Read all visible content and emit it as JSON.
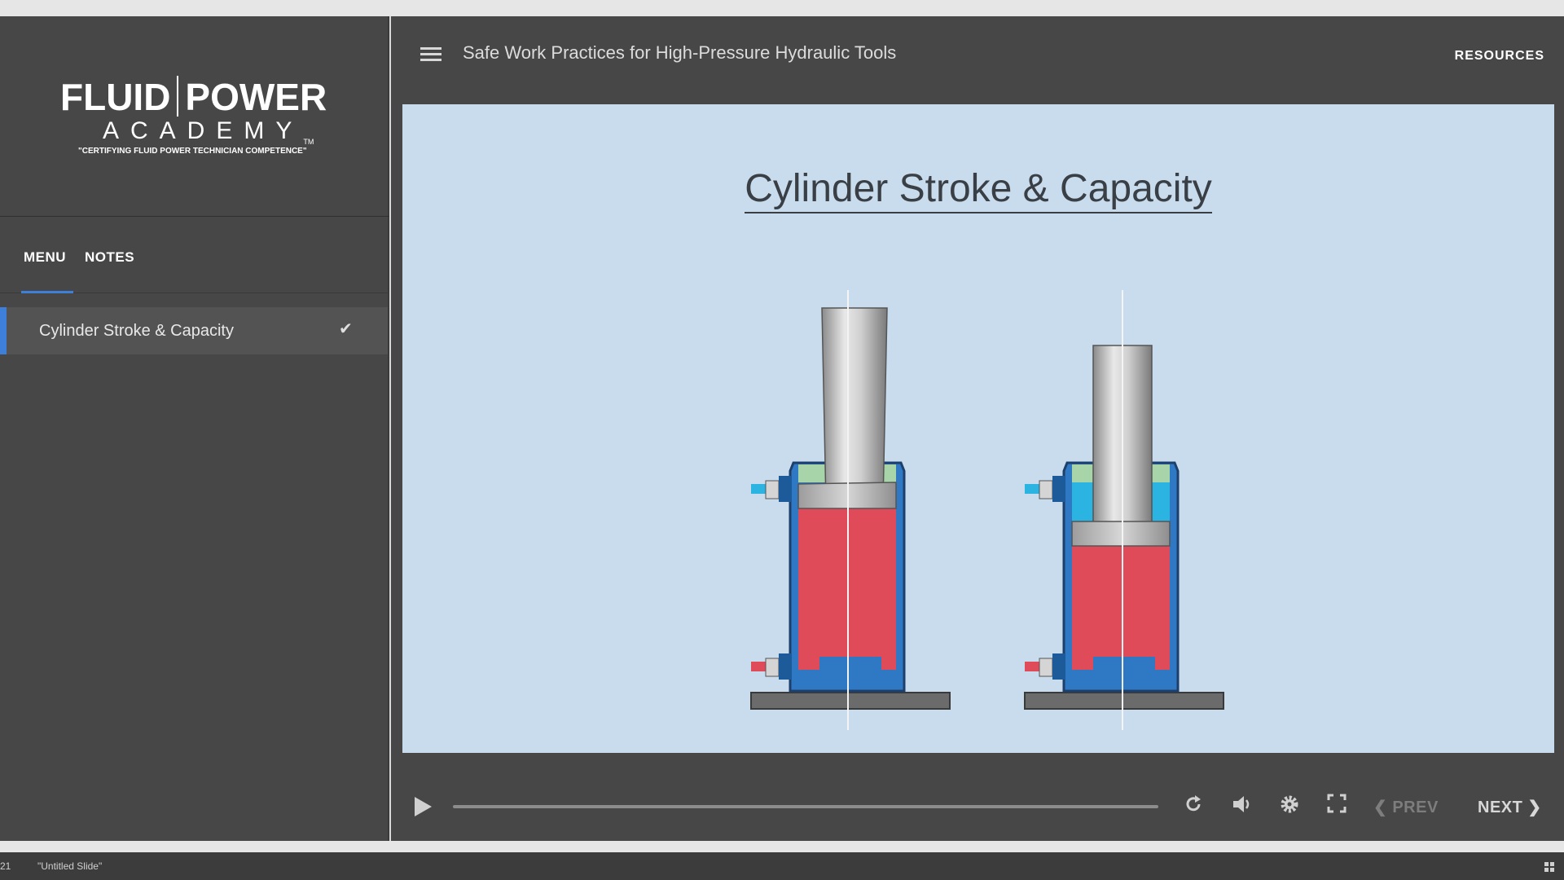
{
  "logo": {
    "line1_left": "FLUID",
    "line1_right": "POWER",
    "line2": "ACADEMY",
    "line2_mark": "TM",
    "tagline": "\"CERTIFYING FLUID POWER TECHNICIAN COMPETENCE\""
  },
  "sidebar": {
    "tabs": [
      {
        "label": "MENU",
        "active": true
      },
      {
        "label": "NOTES",
        "active": false
      }
    ],
    "items": [
      {
        "label": "Cylinder Stroke & Capacity",
        "completed": true,
        "selected": true
      }
    ]
  },
  "header": {
    "course_title": "Safe Work Practices for High-Pressure Hydraulic Tools",
    "resources_label": "RESOURCES"
  },
  "slide": {
    "title": "Cylinder Stroke & Capacity"
  },
  "player": {
    "prev_label": "PREV",
    "next_label": "NEXT",
    "prev_enabled": false,
    "next_enabled": true,
    "progress": 0.0
  },
  "statusbar": {
    "slide_number": "21",
    "slide_name": "\"Untitled Slide\""
  },
  "colors": {
    "accent": "#3d7fd9",
    "slide_bg": "#c8dced",
    "oil_red": "#e04b5a",
    "oil_cyan": "#2bb4e2",
    "cylinder_blue": "#2e78c4"
  }
}
